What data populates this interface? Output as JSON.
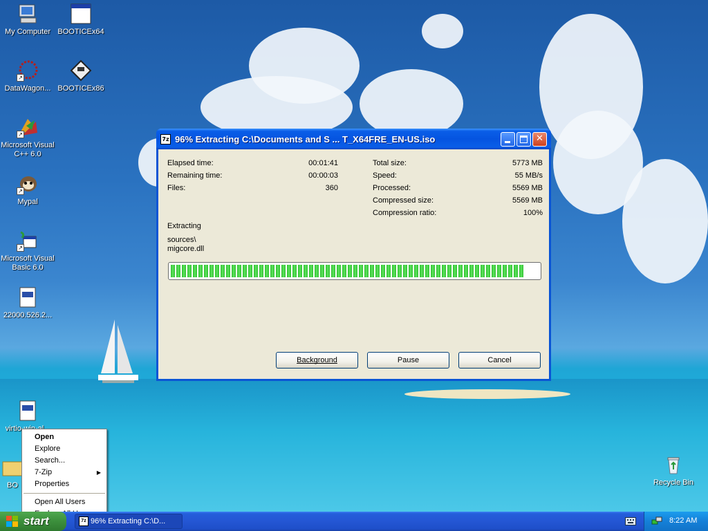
{
  "desktop": {
    "icons": [
      {
        "label": "My Computer",
        "glyph": "my-computer-icon"
      },
      {
        "label": "BOOTICEx64",
        "glyph": "window-app-icon"
      },
      {
        "label": "DataWagon...",
        "glyph": "datawagon-icon"
      },
      {
        "label": "BOOTICEx86",
        "glyph": "floppy-icon"
      },
      {
        "label": "Microsoft Visual C++ 6.0",
        "glyph": "visual-cpp-icon"
      },
      {
        "label": "Mypal",
        "glyph": "mypal-icon"
      },
      {
        "label": "Microsoft Visual Basic 6.0",
        "glyph": "visual-basic-icon"
      },
      {
        "label": "22000.526.2...",
        "glyph": "iso-file-icon"
      },
      {
        "label": "virtio-win-al...",
        "glyph": "iso-file-icon"
      },
      {
        "label": "BO",
        "glyph": "folder-icon"
      },
      {
        "label": "Recycle Bin",
        "glyph": "recycle-bin-icon"
      }
    ]
  },
  "dialog": {
    "icon_text": "7z",
    "title": "96% Extracting C:\\Documents and S ... T_X64FRE_EN-US.iso",
    "stats_left": [
      {
        "label": "Elapsed time:",
        "value": "00:01:41"
      },
      {
        "label": "Remaining time:",
        "value": "00:00:03"
      },
      {
        "label": "Files:",
        "value": "360"
      }
    ],
    "stats_right": [
      {
        "label": "Total size:",
        "value": "5773 MB"
      },
      {
        "label": "Speed:",
        "value": "55 MB/s"
      },
      {
        "label": "Processed:",
        "value": "5569 MB"
      },
      {
        "label": "Compressed size:",
        "value": "5569 MB"
      },
      {
        "label": "Compression ratio:",
        "value": "100%"
      }
    ],
    "status_label": "Extracting",
    "current_path": "sources\\",
    "current_file": "migcore.dll",
    "progress_percent": 96,
    "buttons": {
      "background": "Background",
      "pause": "Pause",
      "cancel": "Cancel"
    }
  },
  "context_menu": {
    "items": [
      {
        "label": "Open",
        "bold": true
      },
      {
        "label": "Explore"
      },
      {
        "label": "Search..."
      },
      {
        "label": "7-Zip",
        "submenu": true
      },
      {
        "label": "Properties"
      },
      {
        "separator": true
      },
      {
        "label": "Open All Users"
      },
      {
        "label": "Explore All Users"
      }
    ]
  },
  "taskbar": {
    "start_label": "start",
    "task_item": "96% Extracting C:\\D...",
    "clock": "8:22 AM"
  },
  "colors": {
    "titlebar": "#0554e0",
    "dialog_bg": "#ece9d8",
    "progress_green": "#2fbf2f",
    "taskbar": "#2456d4"
  }
}
